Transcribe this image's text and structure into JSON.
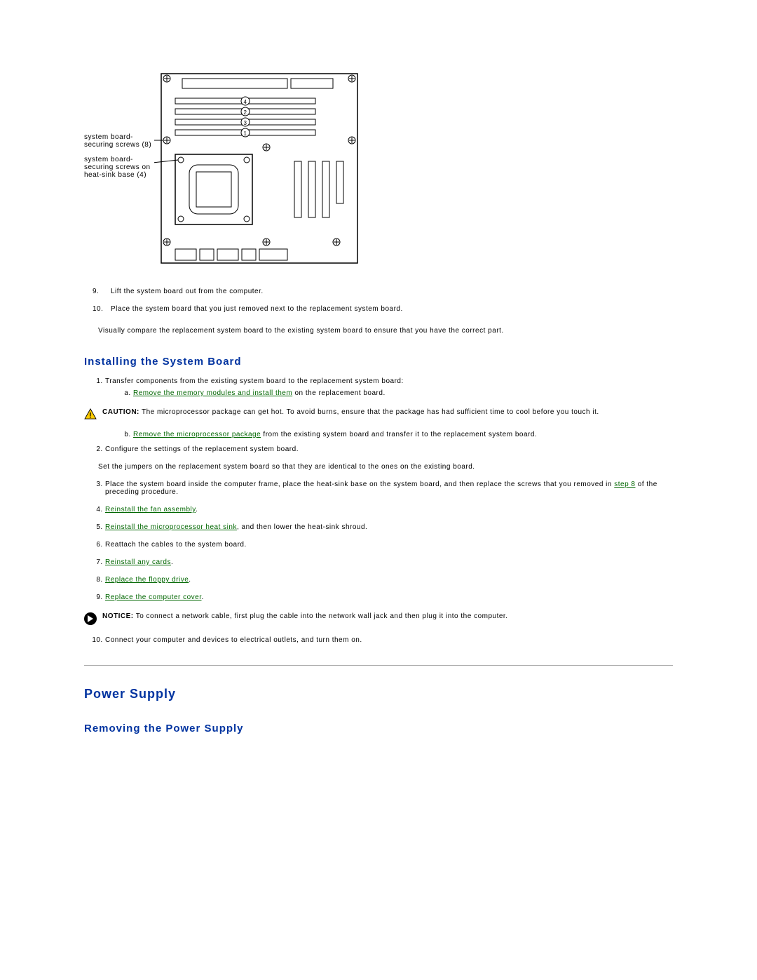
{
  "diagram": {
    "label1": "system board-securing screws (8)",
    "label2": "system board-securing screws on heat-sink base (4)"
  },
  "removal_steps": {
    "s9_num": "9.",
    "s9": "Lift the system board out from the computer.",
    "s10_num": "10.",
    "s10": "Place the system board that you just removed next to the replacement system board."
  },
  "compare_note": "Visually compare the replacement system board to the existing system board to ensure that you have the correct part.",
  "install_heading": "Installing the System Board",
  "install": {
    "s1": "Transfer components from the existing system board to the replacement system board:",
    "s1a_link": "Remove the memory modules and install them",
    "s1a_rest": " on the replacement board.",
    "caution_label": "CAUTION:",
    "caution_text": " The microprocessor package can get hot. To avoid burns, ensure that the package has had sufficient time to cool before you touch it.",
    "s1b_link": "Remove the microprocessor package",
    "s1b_rest": " from the existing system board and transfer it to the replacement system board.",
    "s2": "Configure the settings of the replacement system board.",
    "jumper_note": "Set the jumpers on the replacement system board so that they are identical to the ones on the existing board.",
    "s3_a": "Place the system board inside the computer frame, place the heat-sink base on the system board, and then replace the screws that you removed in ",
    "s3_link": "step 8",
    "s3_b": " of the preceding procedure.",
    "s4_link": "Reinstall the fan assembly",
    "s4_rest": ".",
    "s5_link": "Reinstall the microprocessor heat sink",
    "s5_rest": ", and then lower the heat-sink shroud.",
    "s6": "Reattach the cables to the system board.",
    "s7_link": "Reinstall any cards",
    "s7_rest": ".",
    "s8_link": "Replace the floppy drive",
    "s8_rest": ".",
    "s9_link": "Replace the computer cover",
    "s9_rest": ".",
    "notice_label": "NOTICE:",
    "notice_text": " To connect a network cable, first plug the cable into the network wall jack and then plug it into the computer.",
    "s10": "Connect your computer and devices to electrical outlets, and turn them on."
  },
  "power_heading": "Power Supply",
  "power_sub": "Removing the Power Supply"
}
